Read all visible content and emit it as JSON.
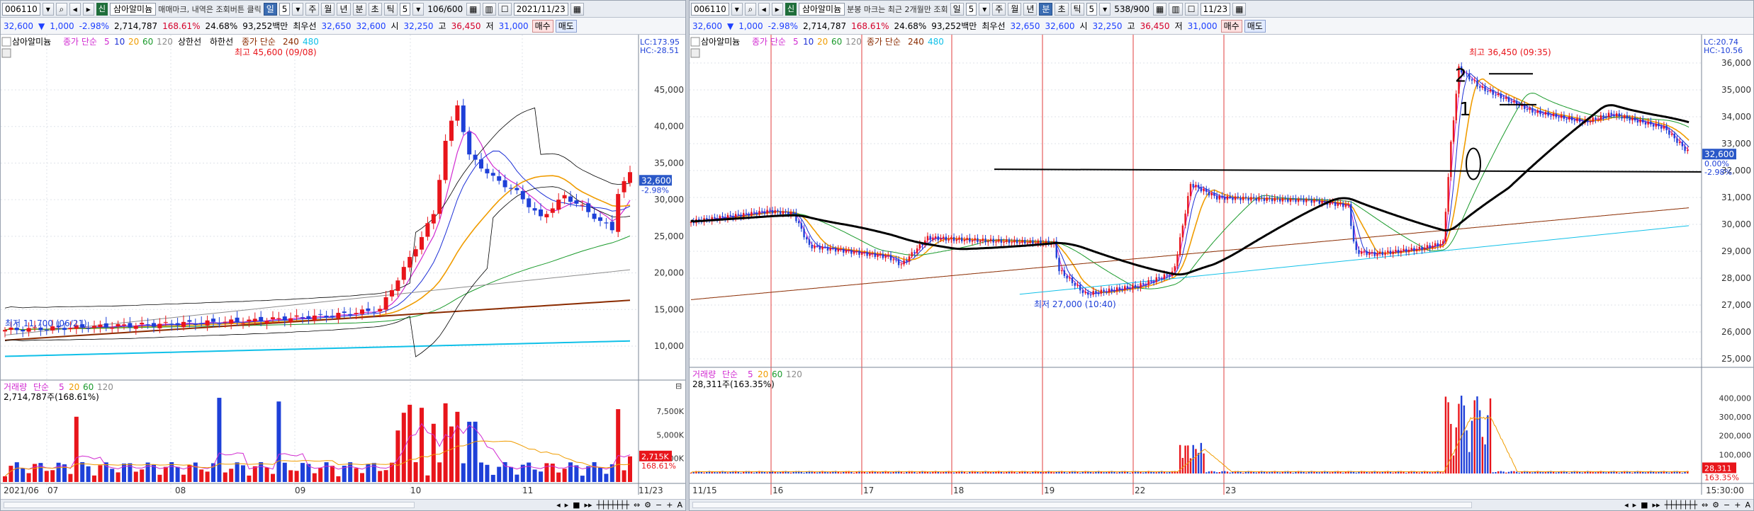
{
  "left": {
    "toolbar": {
      "code": "006110",
      "tag": "신",
      "name": "삼아알미늄",
      "note": "매매마크, 내역은 조회버튼 클릭",
      "period_buttons": [
        "일",
        "주",
        "월",
        "년",
        "분",
        "초",
        "틱"
      ],
      "period_value": "5",
      "tick_value": "5",
      "count": "106/600",
      "date": "2021/11/23"
    },
    "quote": {
      "price": "32,600",
      "arrow": "▼",
      "change": "1,000",
      "change_pct": "-2.98%",
      "volume": "2,714,787",
      "vol_ratio": "168.61%",
      "turnover": "24.68%",
      "amount": "93,252백만",
      "best_label": "최우선",
      "best_ask": "32,650",
      "best_bid": "32,600",
      "open_label": "시",
      "open": "32,250",
      "high_label": "고",
      "high": "36,450",
      "low_label": "저",
      "low": "31,000",
      "buy": "매수",
      "sell": "매도"
    },
    "price_legend": {
      "name": "삼아알미늄",
      "label": "종가 단순",
      "p1": "5",
      "p2": "10",
      "p3": "20",
      "p4": "60",
      "p5": "120",
      "upper": "상한선",
      "lower": "하한선",
      "long_label": "종가 단순",
      "l1": "240",
      "l2": "480"
    },
    "lc": "LC:173.95",
    "hc": "HC:-28.51",
    "annotations": {
      "max": "최고 45,600 (09/08)",
      "min": "최저 11,700 (06/21)"
    },
    "price_ticks": [
      "45,000",
      "40,000",
      "35,000",
      "30,000",
      "25,000",
      "20,000",
      "15,000",
      "10,000"
    ],
    "last_price": "32,600",
    "last_pct": "-2.98%",
    "volume_legend": {
      "label": "거래량",
      "ma": "단순",
      "p1": "5",
      "p2": "20",
      "p3": "60",
      "p4": "120",
      "value": "2,714,787주(168.61%)"
    },
    "volume_ticks": [
      "7,500K",
      "5,000K",
      "2,500K"
    ],
    "last_volume": "2,715K",
    "last_volume_pct": "168.61%",
    "x_labels": [
      "2021/06",
      "07",
      "08",
      "09",
      "10",
      "11",
      "11/23"
    ]
  },
  "right": {
    "toolbar": {
      "code": "006110",
      "tag": "신",
      "name": "삼아알미늄",
      "note": "분봉 마크는 최근 2개월만 조회",
      "period_buttons": [
        "일",
        "주",
        "월",
        "년",
        "분",
        "초",
        "틱"
      ],
      "period_value": "5",
      "tick_value": "5",
      "count": "538/900",
      "date": "11/23"
    },
    "quote": {
      "price": "32,600",
      "arrow": "▼",
      "change": "1,000",
      "change_pct": "-2.98%",
      "volume": "2,714,787",
      "vol_ratio": "168.61%",
      "turnover": "24.68%",
      "amount": "93,252백만",
      "best_label": "최우선",
      "best_ask": "32,650",
      "best_bid": "32,600",
      "open_label": "시",
      "open": "32,250",
      "high_label": "고",
      "high": "36,450",
      "low_label": "저",
      "low": "31,000",
      "buy": "매수",
      "sell": "매도"
    },
    "price_legend": {
      "name": "삼아알미늄",
      "label": "종가 단순",
      "p1": "5",
      "p2": "10",
      "p3": "20",
      "p4": "60",
      "p5": "120",
      "long_label": "종가 단순",
      "l1": "240",
      "l2": "480"
    },
    "lc": "LC:20.74",
    "hc": "HC:-10.56",
    "annotations": {
      "max": "최고 36,450 (09:35)",
      "min": "최저 27,000 (10:40)"
    },
    "price_ticks": [
      "36,000",
      "35,000",
      "34,000",
      "33,000",
      "32,000",
      "31,000",
      "30,000",
      "29,000",
      "28,000",
      "27,000",
      "26,000",
      "25,000"
    ],
    "last_price": "32,600",
    "last_pct": "0.00%",
    "last_pct2": "-2.98%",
    "volume_legend": {
      "label": "거래량",
      "ma": "단순",
      "p1": "5",
      "p2": "20",
      "p3": "60",
      "p4": "120",
      "value": "28,311주(163.35%)"
    },
    "volume_ticks": [
      "400,000",
      "300,000",
      "200,000",
      "100,000"
    ],
    "last_volume": "28,311",
    "last_volume_pct": "163.35%",
    "x_labels": [
      "11/15",
      "16",
      "17",
      "18",
      "19",
      "22",
      "23",
      "15:30:00"
    ],
    "drawn_marks": [
      "2",
      "1"
    ]
  },
  "colors": {
    "up": "#e8151b",
    "down": "#1e40d8",
    "ma5": "#d12bd1",
    "ma10": "#1c2fd6",
    "ma20": "#f09c00",
    "ma60": "#1a9a2b",
    "ma120": "#8c8c8c",
    "ma240": "#8a2b00",
    "ma480": "#10c0e8",
    "axis_bg": "#ffffff",
    "last_price_bg": "#2a58c8",
    "grid": "#dfe3ea"
  }
}
